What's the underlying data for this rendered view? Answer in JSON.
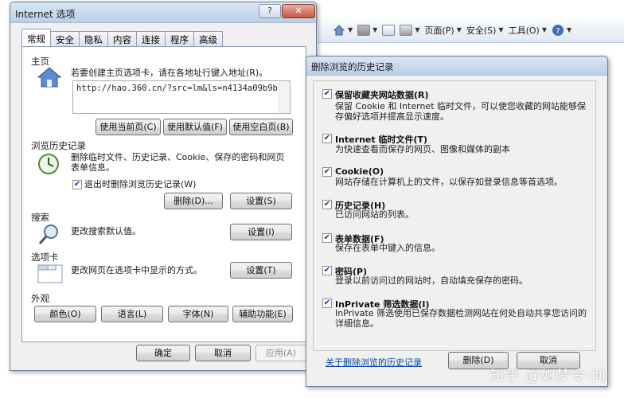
{
  "toolbar": {
    "items": [
      {
        "icon": "home-icon",
        "label": ""
      },
      {
        "icon": "feed-icon",
        "label": ""
      },
      {
        "icon": "mail-icon",
        "label": ""
      },
      {
        "icon": "print-icon",
        "label": ""
      },
      {
        "icon": "page-icon",
        "label": "页面(P)"
      },
      {
        "icon": "safety-icon",
        "label": "安全(S)"
      },
      {
        "icon": "tools-icon",
        "label": "工具(O)"
      },
      {
        "icon": "help-icon",
        "label": ""
      }
    ]
  },
  "options_dialog": {
    "title": "Internet 选项",
    "help_btn": "?",
    "close_btn": "✕",
    "tabs": [
      "常规",
      "安全",
      "隐私",
      "内容",
      "连接",
      "程序",
      "高级"
    ],
    "homepage": {
      "label": "主页",
      "hint": "若要创建主页选项卡，请在各地址行键入地址(R)。",
      "url": "http://hao.360.cn/?src=lm&ls=n4134a09b9b",
      "btn_current": "使用当前页(C)",
      "btn_default": "使用默认值(F)",
      "btn_blank": "使用空白页(B)"
    },
    "history": {
      "label": "浏览历史记录",
      "desc": "删除临时文件、历史记录、Cookie、保存的密码和网页表单信息。",
      "checkbox": "退出时删除浏览历史记录(W)",
      "btn_delete": "删除(D)...",
      "btn_settings": "设置(S)"
    },
    "search": {
      "label": "搜索",
      "desc": "更改搜索默认值。",
      "btn_settings": "设置(I)"
    },
    "tabs_section": {
      "label": "选项卡",
      "desc": "更改网页在选项卡中显示的方式。",
      "btn_settings": "设置(T)"
    },
    "appearance": {
      "label": "外观",
      "btn_colors": "颜色(O)",
      "btn_languages": "语言(L)",
      "btn_fonts": "字体(N)",
      "btn_accessibility": "辅助功能(E)"
    },
    "footer": {
      "ok": "确定",
      "cancel": "取消",
      "apply": "应用(A)"
    }
  },
  "delete_dialog": {
    "title": "删除浏览的历史记录",
    "items": [
      {
        "title": "保留收藏夹网站数据(R)",
        "desc": "保留 Cookie 和 Internet 临时文件，可以使您收藏的网站能够保存偏好选项并提高显示速度。",
        "checked": true
      },
      {
        "title": "Internet 临时文件(T)",
        "desc": "为快速查看而保存的网页、图像和媒体的副本",
        "checked": true
      },
      {
        "title": "Cookie(O)",
        "desc": "网站存储在计算机上的文件，以保存如登录信息等首选项。",
        "checked": true
      },
      {
        "title": "历史记录(H)",
        "desc": "已访问网站的列表。",
        "checked": true
      },
      {
        "title": "表单数据(F)",
        "desc": "保存在表单中键入的信息。",
        "checked": true
      },
      {
        "title": "密码(P)",
        "desc": "登录以前访问过的网站时，自动填充保存的密码。",
        "checked": true
      },
      {
        "title": "InPrivate 筛选数据(I)",
        "desc": "InPrivate 筛选使用已保存数据检测网站在何处自动共享您访问的详细信息。",
        "checked": true
      }
    ],
    "link": "关于删除浏览的历史记录",
    "btn_delete": "删除(D)",
    "btn_cancel": "取消"
  },
  "watermark": "知乎 @如梦令·问"
}
